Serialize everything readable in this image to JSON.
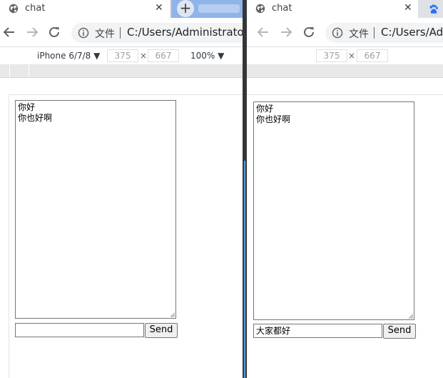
{
  "left": {
    "tab_title": "chat",
    "omnibox": {
      "secure_label": "文件",
      "url": "C:/Users/Administrator/"
    },
    "devtools": {
      "device": "iPhone 6/7/8 ▼",
      "width": "375",
      "times": "×",
      "height": "667",
      "zoom": "100% ▼"
    },
    "chat_log": [
      "你好",
      "你也好啊"
    ],
    "message_input": "",
    "send_label": "Send"
  },
  "right": {
    "tab_title": "chat",
    "omnibox": {
      "secure_label": "文件",
      "url": "C:/Users/Adm"
    },
    "devtools": {
      "width": "375",
      "times": "×",
      "height": "667"
    },
    "chat_log": [
      "你好",
      "你也好啊"
    ],
    "message_input": "大家都好",
    "send_label": "Send"
  },
  "icons": {
    "tab_favicon": "globe-icon",
    "close": "close-icon",
    "new_tab": "plus-icon",
    "back": "back-arrow-icon",
    "forward": "forward-arrow-icon",
    "reload": "reload-icon",
    "info": "info-icon",
    "second_tab_favicon": "baidu-paw-icon"
  },
  "colors": {
    "tabstrip": "#dee1e6",
    "new_tab_area": "#8fb4e8",
    "splitter": "#35363a",
    "omnibox": "#f1f3f4"
  }
}
